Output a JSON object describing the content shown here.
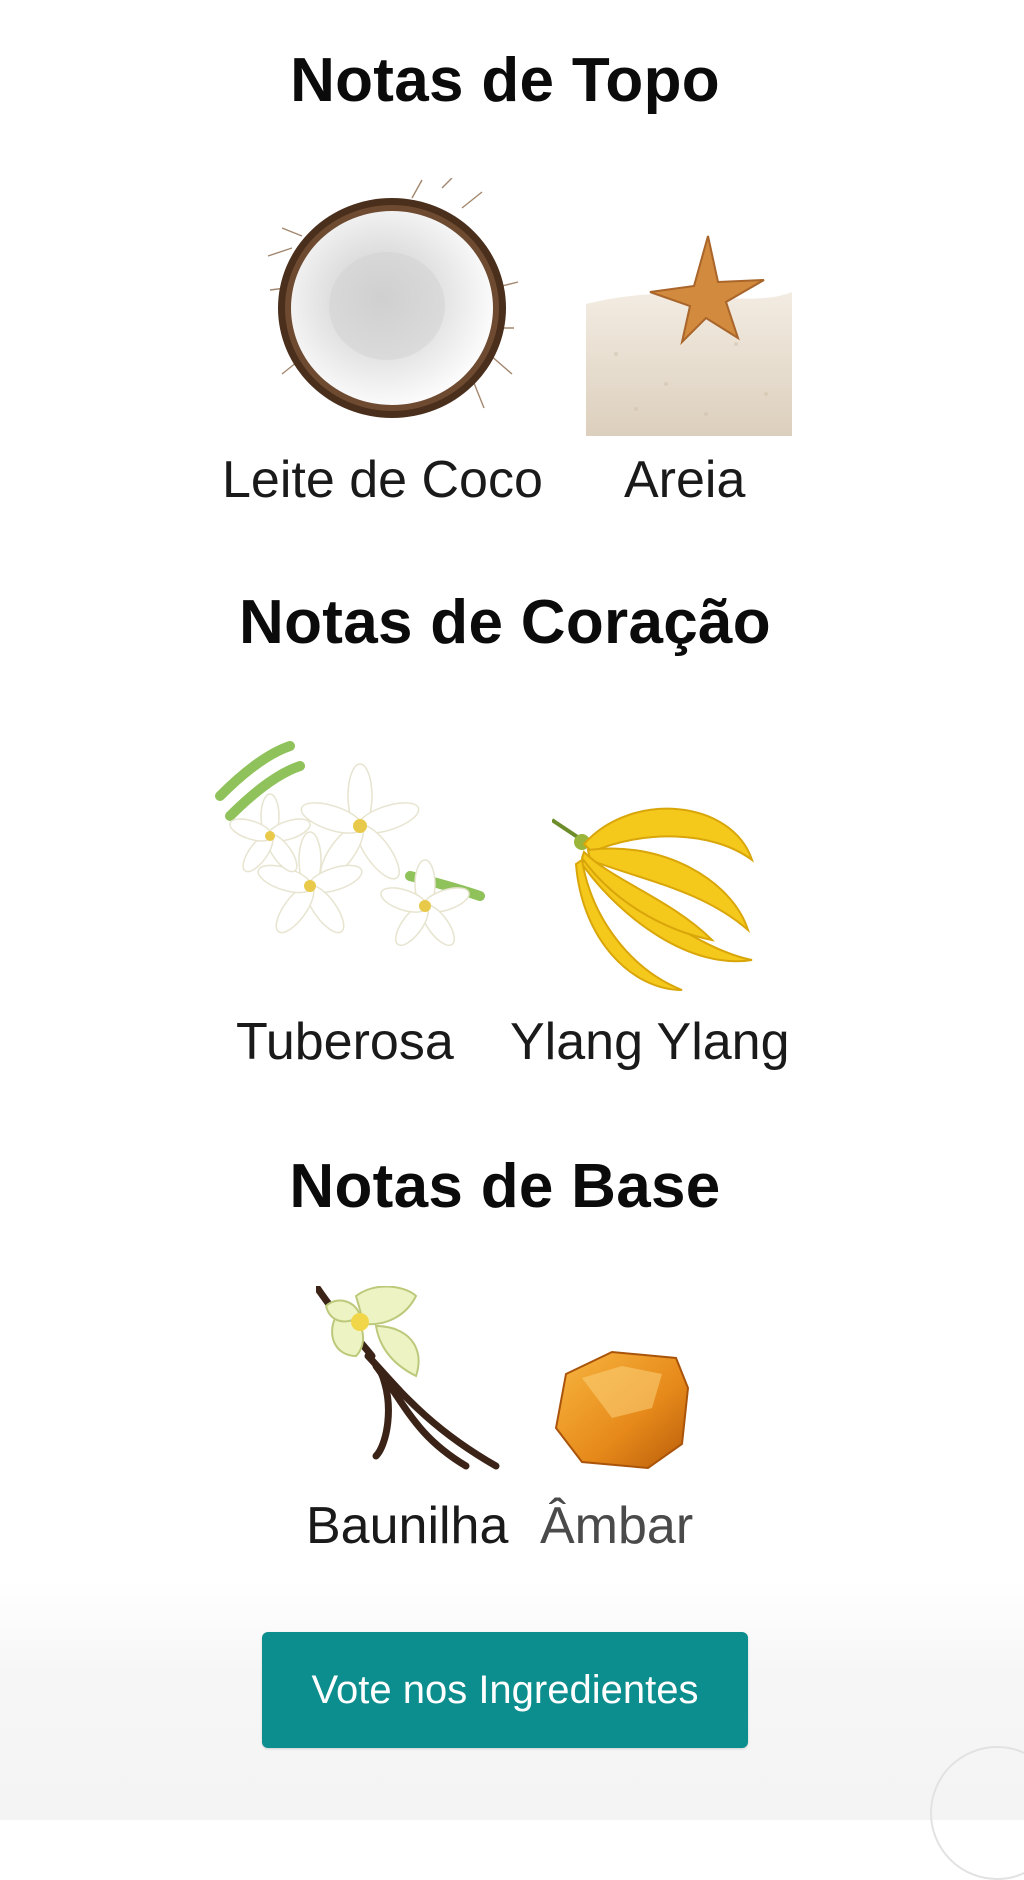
{
  "sections": [
    {
      "title": "Notas de Topo",
      "notes": [
        {
          "label": "Leite de Coco",
          "icon": "coconut-icon"
        },
        {
          "label": "Areia",
          "icon": "starfish-sand-icon"
        }
      ]
    },
    {
      "title": "Notas de Coração",
      "notes": [
        {
          "label": "Tuberosa",
          "icon": "tuberose-flower-icon"
        },
        {
          "label": "Ylang Ylang",
          "icon": "ylang-ylang-flower-icon"
        }
      ]
    },
    {
      "title": "Notas de Base",
      "notes": [
        {
          "label": "Baunilha",
          "icon": "vanilla-icon"
        },
        {
          "label": "Âmbar",
          "icon": "amber-icon"
        }
      ]
    }
  ],
  "cta": {
    "label": "Vote nos Ingredientes"
  },
  "colors": {
    "accent": "#0c8e8f",
    "text": "#111111",
    "background": "#ffffff"
  }
}
